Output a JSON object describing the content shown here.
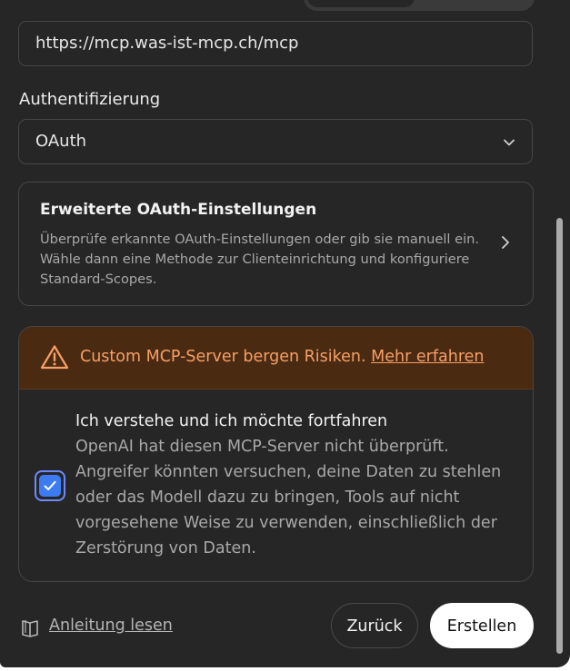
{
  "url_field": {
    "value": "https://mcp.was-ist-mcp.ch/mcp"
  },
  "auth": {
    "label": "Authentifizierung",
    "selected": "OAuth"
  },
  "advanced": {
    "title": "Erweiterte OAuth-Einstellungen",
    "description": "Überprüfe erkannte OAuth-Einstellungen oder gib sie manuell ein. Wähle dann eine Methode zur Clienteinrichtung und konfiguriere Standard-Scopes."
  },
  "warning": {
    "text": "Custom MCP-Server bergen Risiken.",
    "link": "Mehr erfahren",
    "color": "#f5a066",
    "background": "#4b2a12"
  },
  "acknowledge": {
    "checked": true,
    "title": "Ich verstehe und ich möchte fortfahren",
    "description": "OpenAI hat diesen MCP-Server nicht überprüft. Angreifer könnten versuchen, deine Daten zu stehlen oder das Modell dazu zu bringen, Tools auf nicht vorgesehene Weise zu verwenden, einschließlich der Zerstörung von Daten."
  },
  "footer": {
    "guide_link": "Anleitung lesen",
    "back_label": "Zurück",
    "create_label": "Erstellen"
  },
  "icons": {
    "select": "chevron-down-icon",
    "advanced": "chevron-right-icon",
    "warning": "warning-triangle-icon",
    "checkbox": "checkmark-icon",
    "guide": "book-icon"
  },
  "colors": {
    "dialog_background": "#262626",
    "accent": "#3d7bf2"
  }
}
